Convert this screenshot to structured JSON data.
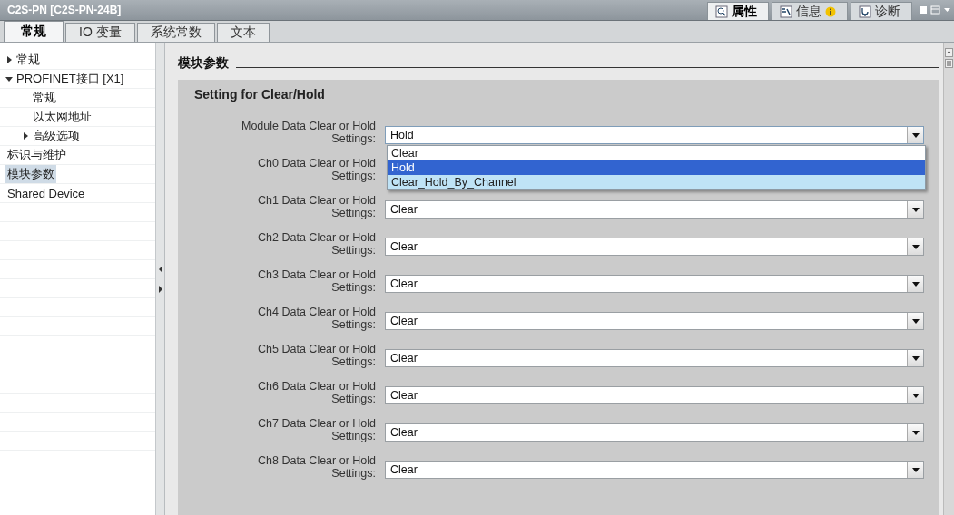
{
  "window": {
    "title": "C2S-PN [C2S-PN-24B]"
  },
  "inspector_tabs": [
    {
      "label": "属性",
      "selected": true,
      "alert": false
    },
    {
      "label": "信息",
      "selected": false,
      "alert": true
    },
    {
      "label": "诊断",
      "selected": false,
      "alert": false
    }
  ],
  "tabs": [
    {
      "label": "常规",
      "selected": true
    },
    {
      "label": "IO 变量",
      "selected": false
    },
    {
      "label": "系统常数",
      "selected": false
    },
    {
      "label": "文本",
      "selected": false
    }
  ],
  "tree": [
    {
      "label": "常规",
      "selected": false,
      "expanded": false
    },
    {
      "label": "PROFINET接口 [X1]",
      "selected": false,
      "expanded": true,
      "children": [
        {
          "label": "常规",
          "selected": false
        },
        {
          "label": "以太网地址",
          "selected": false
        },
        {
          "label": "高级选项",
          "selected": false,
          "expanded": false
        }
      ]
    },
    {
      "label": "标识与维护",
      "selected": false
    },
    {
      "label": "模块参数",
      "selected": true
    },
    {
      "label": "Shared Device",
      "selected": false
    }
  ],
  "section_title": "模块参数",
  "group_title": "Setting for Clear/Hold",
  "settings": [
    {
      "label": "Module Data Clear or Hold Settings:",
      "value": "Hold",
      "options": [
        {
          "label": "Clear",
          "selected": false,
          "hovered": false
        },
        {
          "label": "Hold",
          "selected": true,
          "hovered": false
        },
        {
          "label": "Clear_Hold_By_Channel",
          "selected": false,
          "hovered": true
        }
      ]
    },
    {
      "label": "Ch0 Data Clear or Hold Settings:"
    },
    {
      "label": "Ch1 Data Clear or Hold Settings:",
      "value": "Clear"
    },
    {
      "label": "Ch2 Data Clear or Hold Settings:",
      "value": "Clear"
    },
    {
      "label": "Ch3 Data Clear or Hold Settings:",
      "value": "Clear"
    },
    {
      "label": "Ch4 Data Clear or Hold Settings:",
      "value": "Clear"
    },
    {
      "label": "Ch5 Data Clear or Hold Settings:",
      "value": "Clear"
    },
    {
      "label": "Ch6 Data Clear or Hold Settings:",
      "value": "Clear"
    },
    {
      "label": "Ch7 Data Clear or Hold Settings:",
      "value": "Clear"
    },
    {
      "label": "Ch8 Data Clear or Hold Settings:",
      "value": "Clear"
    }
  ]
}
